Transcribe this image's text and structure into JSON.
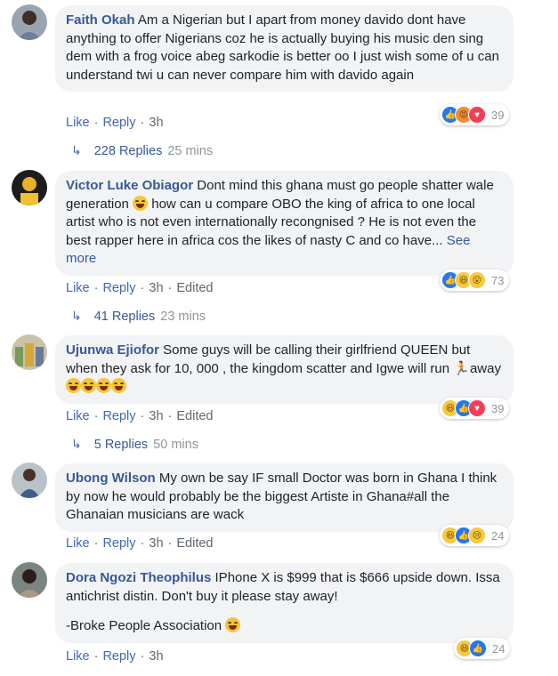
{
  "comments": [
    {
      "author": "Faith Okah",
      "text": "Am a Nigerian but I apart from money davido dont have anything to offer Nigerians coz he is actually buying his music den sing dem with a frog voice abeg sarkodie is better oo I just wish some of u can understand twi u can never compare him with davido again",
      "like": "Like",
      "reply": "Reply",
      "time": "3h",
      "reaction_count": "39",
      "replies": "228 Replies",
      "replies_time": "25 mins"
    },
    {
      "author": "Victor Luke Obiagor",
      "text_a": "Dont mind this ghana must go people shatter wale generation",
      "text_b": "how can u compare OBO the king of africa to one local artist who is not even internationally recongnised ? He is not even the best rapper here in africa cos the likes of nasty C and co have...",
      "see_more": "See more",
      "like": "Like",
      "reply": "Reply",
      "time": "3h",
      "edited": "Edited",
      "reaction_count": "73",
      "replies": "41 Replies",
      "replies_time": "23 mins"
    },
    {
      "author": "Ujunwa Ejiofor",
      "text_a": "Some guys will be calling their girlfriend QUEEN but when they ask for 10, 000 , the kingdom scatter and Igwe will run",
      "text_b": "away",
      "like": "Like",
      "reply": "Reply",
      "time": "3h",
      "edited": "Edited",
      "reaction_count": "39",
      "replies": "5 Replies",
      "replies_time": "50 mins"
    },
    {
      "author": "Ubong Wilson",
      "text": "My own be say IF small Doctor was born in Ghana I think by now he would probably be the biggest Artiste in Ghana#all the Ghanaian musicians are wack",
      "like": "Like",
      "reply": "Reply",
      "time": "3h",
      "edited": "Edited",
      "reaction_count": "24"
    },
    {
      "author": "Dora Ngozi Theophilus",
      "text": "IPhone X is $999 that is $666 upside down. Issa antichrist distin. Don't buy it please stay away!",
      "text2": "-Broke People Association",
      "like": "Like",
      "reply": "Reply",
      "time": "3h",
      "reaction_count": "24"
    }
  ],
  "colors": {
    "author": "#385898",
    "bubble": "#f2f3f5",
    "link": "#4267b2",
    "meta": "#90949c"
  }
}
